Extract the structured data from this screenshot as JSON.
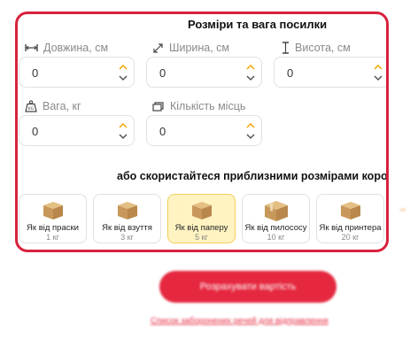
{
  "section": {
    "title": "Розміри та вага посилки",
    "fields": [
      {
        "label": "Довжина, см",
        "value": "0",
        "icon": "length-arrows-icon"
      },
      {
        "label": "Ширина, см",
        "value": "0",
        "icon": "diagonal-arrows-icon"
      },
      {
        "label": "Висота, см",
        "value": "0",
        "icon": "height-bar-icon"
      },
      {
        "label": "Вага, кг",
        "value": "0",
        "icon": "weight-kg-icon"
      },
      {
        "label": "Кількість місць",
        "value": "0",
        "icon": "boxes-stack-icon"
      }
    ],
    "presets_title": "або скористайтеся приблизними розмірами коробок",
    "presets": [
      {
        "name": "Як від праски",
        "weight": "1 кг",
        "selected": false
      },
      {
        "name": "Як від взуття",
        "weight": "3 кг",
        "selected": false
      },
      {
        "name": "Як від паперу",
        "weight": "5 кг",
        "selected": true
      },
      {
        "name": "Як від пилососу",
        "weight": "10 кг",
        "selected": false
      },
      {
        "name": "Як від принтера",
        "weight": "20 кг",
        "selected": false
      }
    ]
  },
  "actions": {
    "calculate_label": "Розрахувати вартість",
    "forbidden_link": "Список заборонених речей для відправлення"
  },
  "colors": {
    "accent": "#d8223d",
    "selected_bg": "#fff3c2",
    "spinner_up": "#f2a600"
  }
}
